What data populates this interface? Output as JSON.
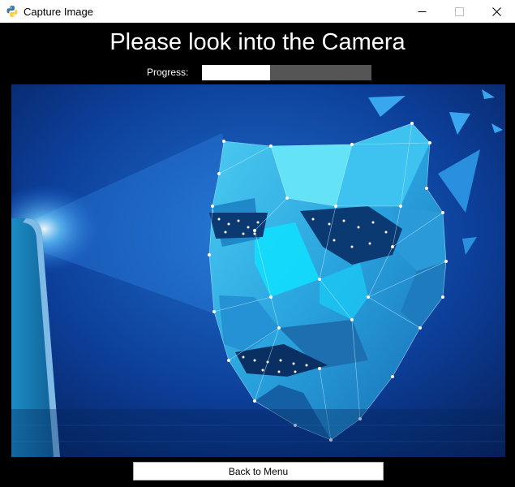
{
  "window": {
    "title": "Capture Image",
    "icon": "python-icon",
    "controls": [
      "minimize-icon",
      "maximize-icon",
      "close-icon"
    ]
  },
  "headline": "Please look into the Camera",
  "progress": {
    "label": "Progress:",
    "value": 0.4
  },
  "camera": {
    "description_icon": "face-mesh-image"
  },
  "back_button": {
    "label": "Back to Menu"
  },
  "colors": {
    "background": "#000000",
    "progress_fill": "#ffffff",
    "progress_track": "#555555",
    "accent": "#1fb6f0"
  }
}
